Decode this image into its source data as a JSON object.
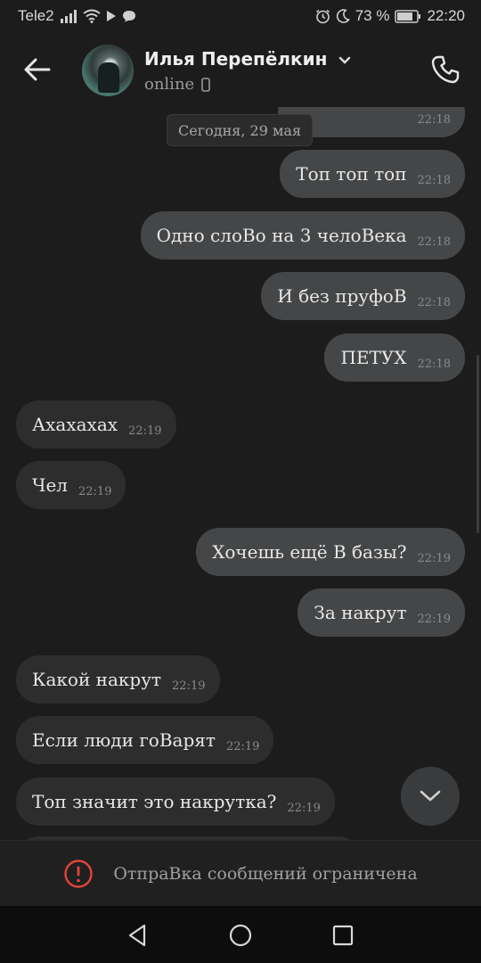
{
  "status_bar": {
    "carrier": "Tele2",
    "battery_percent": "73 %",
    "time": "22:20"
  },
  "header": {
    "contact_name": "Илья Перепёлкин",
    "status": "online"
  },
  "chat": {
    "date_separator": "Сегодня, 29 мая",
    "partial_top_time": "22:18",
    "messages": [
      {
        "dir": "out",
        "text": "Топ топ топ",
        "time": "22:18"
      },
      {
        "dir": "out",
        "text": "Одно слоВо на 3 челоВека",
        "time": "22:18"
      },
      {
        "dir": "out",
        "text": "И без пруфоВ",
        "time": "22:18"
      },
      {
        "dir": "out",
        "text": "ПЕТУХ",
        "time": "22:18"
      },
      {
        "dir": "in",
        "text": "Ахахахах",
        "time": "22:19"
      },
      {
        "dir": "in",
        "text": "Чел",
        "time": "22:19"
      },
      {
        "dir": "out",
        "text": "Хочешь ещё В базы?",
        "time": "22:19"
      },
      {
        "dir": "out",
        "text": "За накрут",
        "time": "22:19"
      },
      {
        "dir": "in",
        "text": "Какой накрут",
        "time": "22:19"
      },
      {
        "dir": "in",
        "text": "Если люди гоВарят",
        "time": "22:19"
      },
      {
        "dir": "in",
        "text": "Топ значит это накрутка?",
        "time": "22:19"
      }
    ]
  },
  "composer": {
    "restriction_text": "ОтпраВка сообщений ограничена"
  },
  "colors": {
    "background": "#1c1c1c",
    "outgoing_bubble": "#454647",
    "incoming_bubble": "#2d2d2e",
    "warning_red": "#e0443a"
  },
  "icons": {
    "back": "arrow-left-icon",
    "call": "phone-icon",
    "scroll_down": "chevron-down-icon",
    "warning": "exclamation-circle-icon"
  }
}
